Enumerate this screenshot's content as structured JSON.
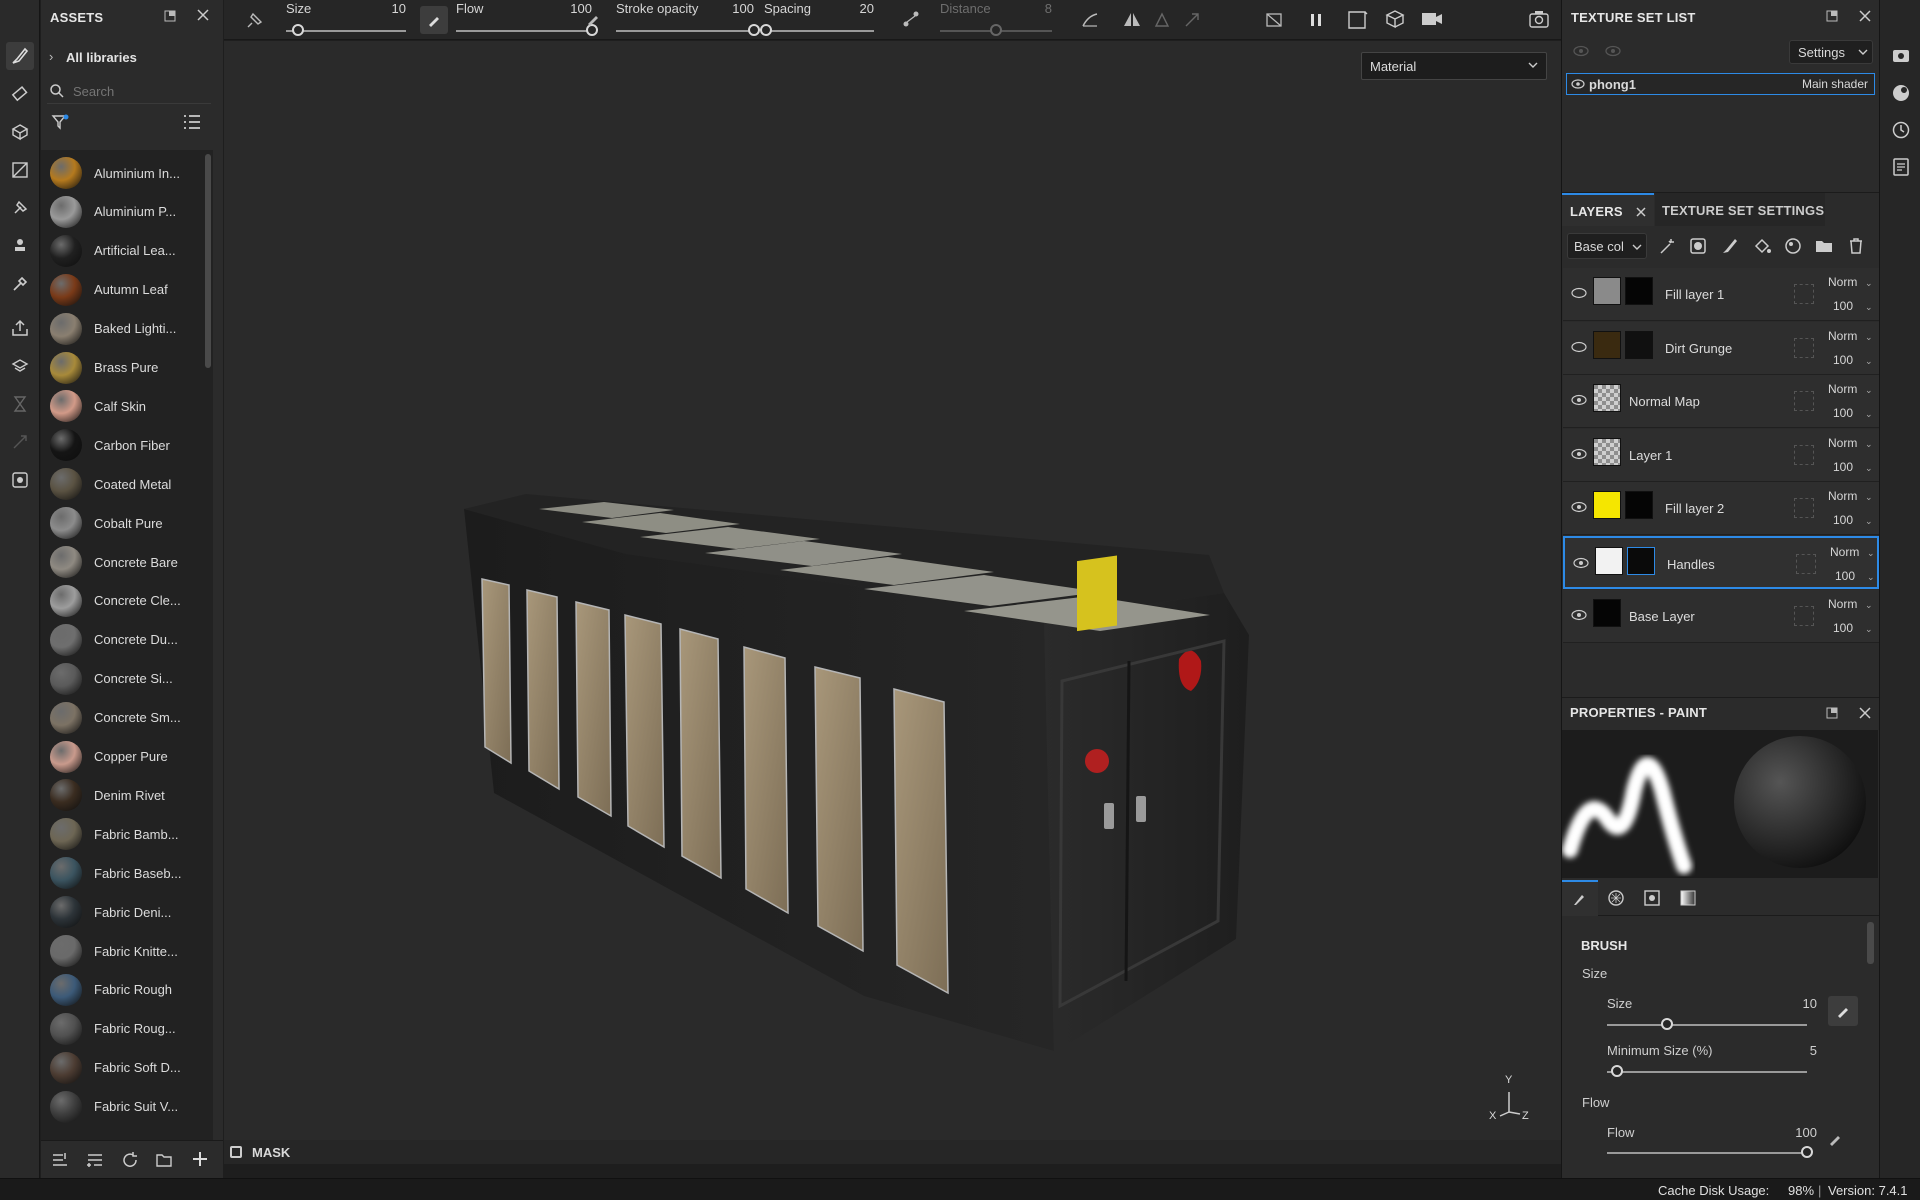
{
  "assets": {
    "title": "ASSETS",
    "library_label": "All libraries",
    "search_placeholder": "Search",
    "items": [
      {
        "name": "Aluminium In...",
        "color": "#b57a1e"
      },
      {
        "name": "Aluminium P...",
        "color": "#9a9a9a"
      },
      {
        "name": "Artificial Lea...",
        "color": "#202020"
      },
      {
        "name": "Autumn Leaf",
        "color": "#7a3a18"
      },
      {
        "name": "Baked Lighti...",
        "color": "#8a7f70"
      },
      {
        "name": "Brass Pure",
        "color": "#a88a3a"
      },
      {
        "name": "Calf Skin",
        "color": "#d29a88"
      },
      {
        "name": "Carbon Fiber",
        "color": "#151515"
      },
      {
        "name": "Coated Metal",
        "color": "#5a5242"
      },
      {
        "name": "Cobalt Pure",
        "color": "#8c8c8c"
      },
      {
        "name": "Concrete Bare",
        "color": "#8f8a82"
      },
      {
        "name": "Concrete Cle...",
        "color": "#9d9d9d"
      },
      {
        "name": "Concrete Du...",
        "color": "#6e6e6e"
      },
      {
        "name": "Concrete Si...",
        "color": "#5a5a5a"
      },
      {
        "name": "Concrete Sm...",
        "color": "#7c7264"
      },
      {
        "name": "Copper Pure",
        "color": "#c99a8c"
      },
      {
        "name": "Denim Rivet",
        "color": "#3a2c20"
      },
      {
        "name": "Fabric Bamb...",
        "color": "#6d6654"
      },
      {
        "name": "Fabric Baseb...",
        "color": "#3b5460"
      },
      {
        "name": "Fabric Deni...",
        "color": "#2c3338"
      },
      {
        "name": "Fabric Knitte...",
        "color": "#6a6a6a"
      },
      {
        "name": "Fabric Rough",
        "color": "#3c5a78"
      },
      {
        "name": "Fabric Roug...",
        "color": "#505050"
      },
      {
        "name": "Fabric Soft D...",
        "color": "#4c3c32"
      },
      {
        "name": "Fabric Suit V...",
        "color": "#3e3e3e"
      }
    ]
  },
  "toolbar": {
    "size_label": "Size",
    "size_value": "10",
    "size_level": 0.1,
    "flow_label": "Flow",
    "flow_value": "100",
    "flow_level": 1.0,
    "stroke_opacity_label": "Stroke opacity",
    "stroke_opacity_value": "100",
    "stroke_opacity_level": 1.0,
    "spacing_label": "Spacing",
    "spacing_value": "20",
    "spacing_level": 0.02,
    "distance_label": "Distance",
    "distance_value": "8",
    "distance_level": 0.5
  },
  "viewport": {
    "mode_select": "Material",
    "mask_label": "MASK",
    "axis_y": "Y",
    "axis_x": "X",
    "axis_z": "Z"
  },
  "texture_set_list": {
    "title": "TEXTURE SET LIST",
    "settings_label": "Settings",
    "item_name": "phong1",
    "item_shader": "Main shader"
  },
  "layers_panel": {
    "tab_layers": "LAYERS",
    "tab_texture_set_settings": "TEXTURE SET SETTINGS",
    "channel_select": "Base col",
    "layers": [
      {
        "name": "Fill layer 1",
        "blend": "Norm",
        "opacity": "100",
        "thumb": "#8a8a8a",
        "mask": "#050505",
        "selected": false
      },
      {
        "name": "Dirt Grunge",
        "blend": "Norm",
        "opacity": "100",
        "thumb": "#3a2a10",
        "mask": "#101010",
        "selected": false
      },
      {
        "name": "Normal Map",
        "blend": "Norm",
        "opacity": "100",
        "thumb": "checker",
        "mask": "",
        "selected": false
      },
      {
        "name": "Layer 1",
        "blend": "Norm",
        "opacity": "100",
        "thumb": "checker",
        "mask": "",
        "selected": false
      },
      {
        "name": "Fill layer 2",
        "blend": "Norm",
        "opacity": "100",
        "thumb": "#f5e600",
        "mask": "#050505",
        "selected": false
      },
      {
        "name": "Handles",
        "blend": "Norm",
        "opacity": "100",
        "thumb": "#f2f2f2",
        "mask": "#0a0a0a",
        "selected": true
      },
      {
        "name": "Base Layer",
        "blend": "Norm",
        "opacity": "100",
        "thumb": "#050505",
        "mask": "",
        "selected": false
      }
    ]
  },
  "properties": {
    "title": "PROPERTIES - PAINT",
    "section_brush": "BRUSH",
    "group_size": "Size",
    "size_label": "Size",
    "size_value": "10",
    "size_level": 0.3,
    "min_size_label": "Minimum Size (%)",
    "min_size_value": "5",
    "min_size_level": 0.05,
    "group_flow": "Flow",
    "flow_label": "Flow",
    "flow_value": "100",
    "flow_level": 1.0
  },
  "status": {
    "cache_label": "Cache Disk Usage:",
    "cache_value": "98%",
    "version": "Version: 7.4.1"
  },
  "colors": {
    "accent": "#2d8ae6",
    "panel": "#2b2b2b",
    "viewport": "#2a2a2a"
  }
}
